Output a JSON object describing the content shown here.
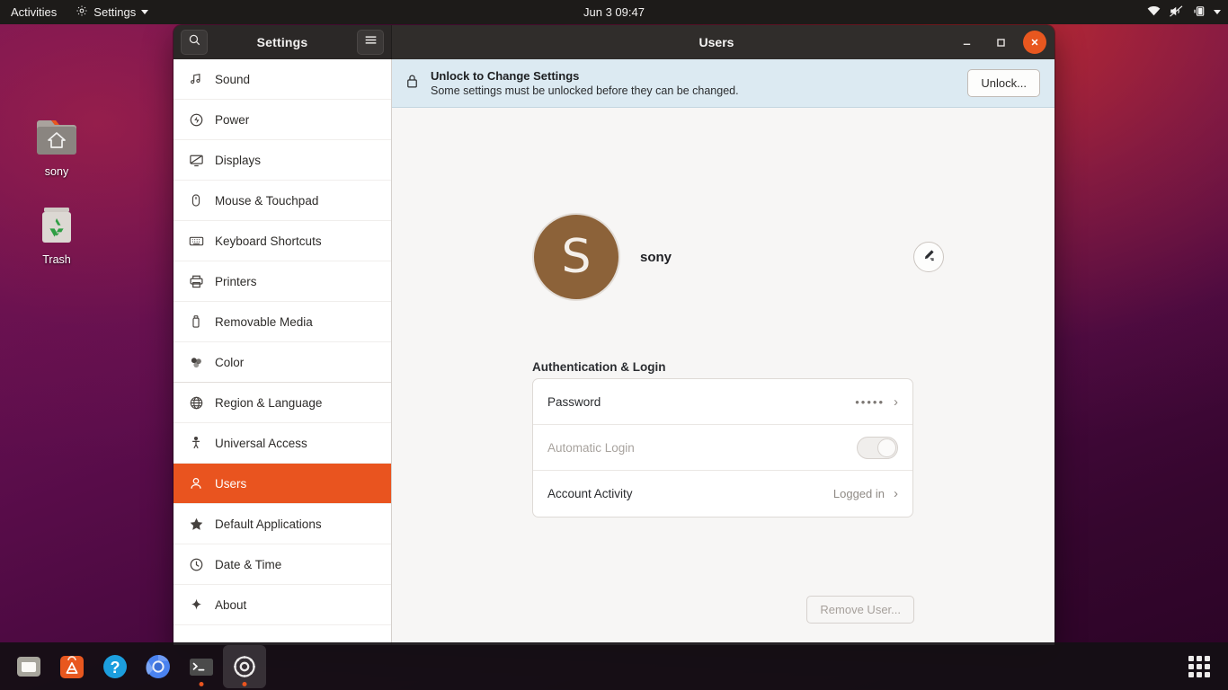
{
  "topbar": {
    "activities": "Activities",
    "app_menu": "Settings",
    "app_menu_icon": "gear-icon",
    "clock": "Jun 3  09:47",
    "indicators": [
      {
        "name": "wifi-icon"
      },
      {
        "name": "volume-muted-icon"
      },
      {
        "name": "battery-charging-icon"
      },
      {
        "name": "chevron-down-icon"
      }
    ]
  },
  "desktop": {
    "icons": [
      {
        "label": "sony",
        "icon": "home-folder-icon"
      },
      {
        "label": "Trash",
        "icon": "trash-icon"
      }
    ]
  },
  "window": {
    "sidebar_title": "Settings",
    "main_title": "Users",
    "search_icon": "search-icon",
    "menu_icon": "hamburger-menu-icon",
    "controls": {
      "minimize": "–",
      "maximize": "☐",
      "close": "✕"
    }
  },
  "sidebar": {
    "items": [
      {
        "label": "Sound",
        "icon": "sound-icon"
      },
      {
        "label": "Power",
        "icon": "power-icon"
      },
      {
        "label": "Displays",
        "icon": "display-icon"
      },
      {
        "label": "Mouse & Touchpad",
        "icon": "mouse-icon"
      },
      {
        "label": "Keyboard Shortcuts",
        "icon": "keyboard-icon"
      },
      {
        "label": "Printers",
        "icon": "printer-icon"
      },
      {
        "label": "Removable Media",
        "icon": "usb-drive-icon"
      },
      {
        "label": "Color",
        "icon": "color-icon"
      },
      {
        "label": "Region & Language",
        "icon": "globe-icon"
      },
      {
        "label": "Universal Access",
        "icon": "accessibility-icon"
      },
      {
        "label": "Users",
        "icon": "user-icon",
        "selected": true
      },
      {
        "label": "Default Applications",
        "icon": "star-icon"
      },
      {
        "label": "Date & Time",
        "icon": "clock-icon"
      },
      {
        "label": "About",
        "icon": "sparkle-icon"
      }
    ]
  },
  "banner": {
    "icon": "lock-icon",
    "title": "Unlock to Change Settings",
    "subtitle": "Some settings must be unlocked before they can be changed.",
    "button": "Unlock..."
  },
  "user": {
    "avatar_initial": "S",
    "avatar_color": "#8c6239",
    "name": "sony",
    "edit_icon": "pencil-edit-icon"
  },
  "auth_section": {
    "title": "Authentication & Login",
    "rows": [
      {
        "label": "Password",
        "value": "•••••",
        "chevron": "›",
        "type": "navigate"
      },
      {
        "label": "Automatic Login",
        "value": "",
        "type": "toggle",
        "toggle_on": false,
        "disabled": true
      },
      {
        "label": "Account Activity",
        "value": "Logged in",
        "chevron": "›",
        "type": "navigate"
      }
    ]
  },
  "footer": {
    "remove_user": "Remove User...",
    "remove_user_disabled": true
  },
  "dock": {
    "items": [
      {
        "name": "files-icon",
        "active": false,
        "running": false
      },
      {
        "name": "ubuntu-software-icon",
        "active": false,
        "running": false
      },
      {
        "name": "help-icon",
        "active": false,
        "running": false
      },
      {
        "name": "chromium-icon",
        "active": false,
        "running": false
      },
      {
        "name": "terminal-icon",
        "active": false,
        "running": true
      },
      {
        "name": "settings-icon",
        "active": true,
        "running": true
      }
    ],
    "show_apps_icon": "app-grid-icon"
  },
  "colors": {
    "accent": "#e9541f",
    "close_button": "#e8571f",
    "banner_bg": "#dceaf2",
    "topbar_bg": "#1d1b19"
  }
}
